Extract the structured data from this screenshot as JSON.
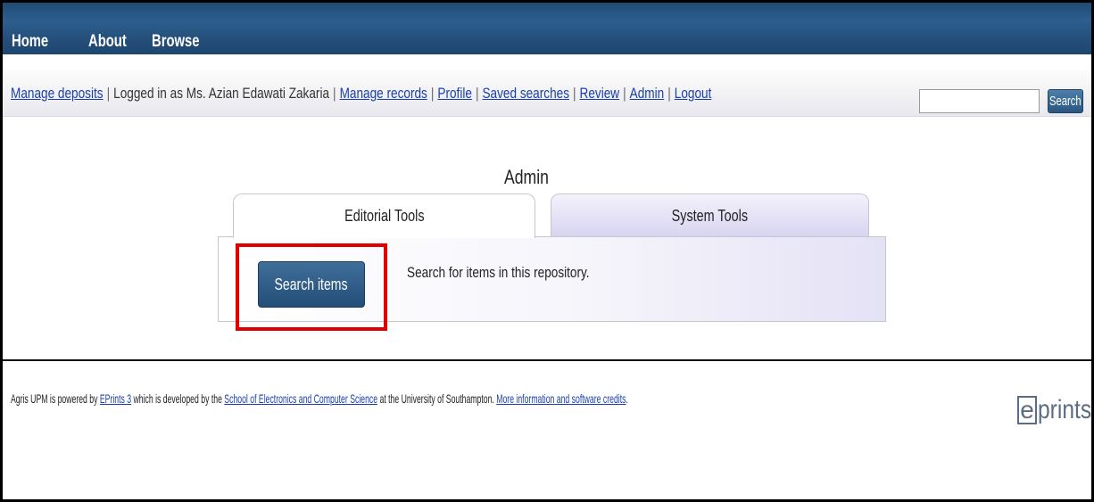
{
  "topnav": {
    "items": [
      "Home",
      "About",
      "Browse"
    ]
  },
  "userbar": {
    "manage_deposits": "Manage deposits",
    "logged_in_text": "Logged in as Ms. Azian Edawati Zakaria",
    "links": [
      "Manage records",
      "Profile",
      "Saved searches",
      "Review",
      "Admin",
      "Logout"
    ],
    "separator": "|",
    "search_button": "Search",
    "search_value": ""
  },
  "admin": {
    "title": "Admin",
    "tabs": [
      "Editorial Tools",
      "System Tools"
    ],
    "search_items_button": "Search items",
    "search_items_description": "Search for items in this repository."
  },
  "footer": {
    "text1": "Agris UPM is powered by ",
    "link1": "EPrints 3",
    "text2": " which is developed by the ",
    "link2": "School of Electronics and Computer Science",
    "text3": " at the University of Southampton. ",
    "link3": "More information and software credits",
    "text4": "."
  },
  "logo": {
    "e": "e",
    "rest": "prints"
  },
  "colors": {
    "nav_bg": "#2c5f8e",
    "link": "#1b3fa8",
    "highlight": "#e00000",
    "tab_system_bg": "#d6d3f0"
  }
}
